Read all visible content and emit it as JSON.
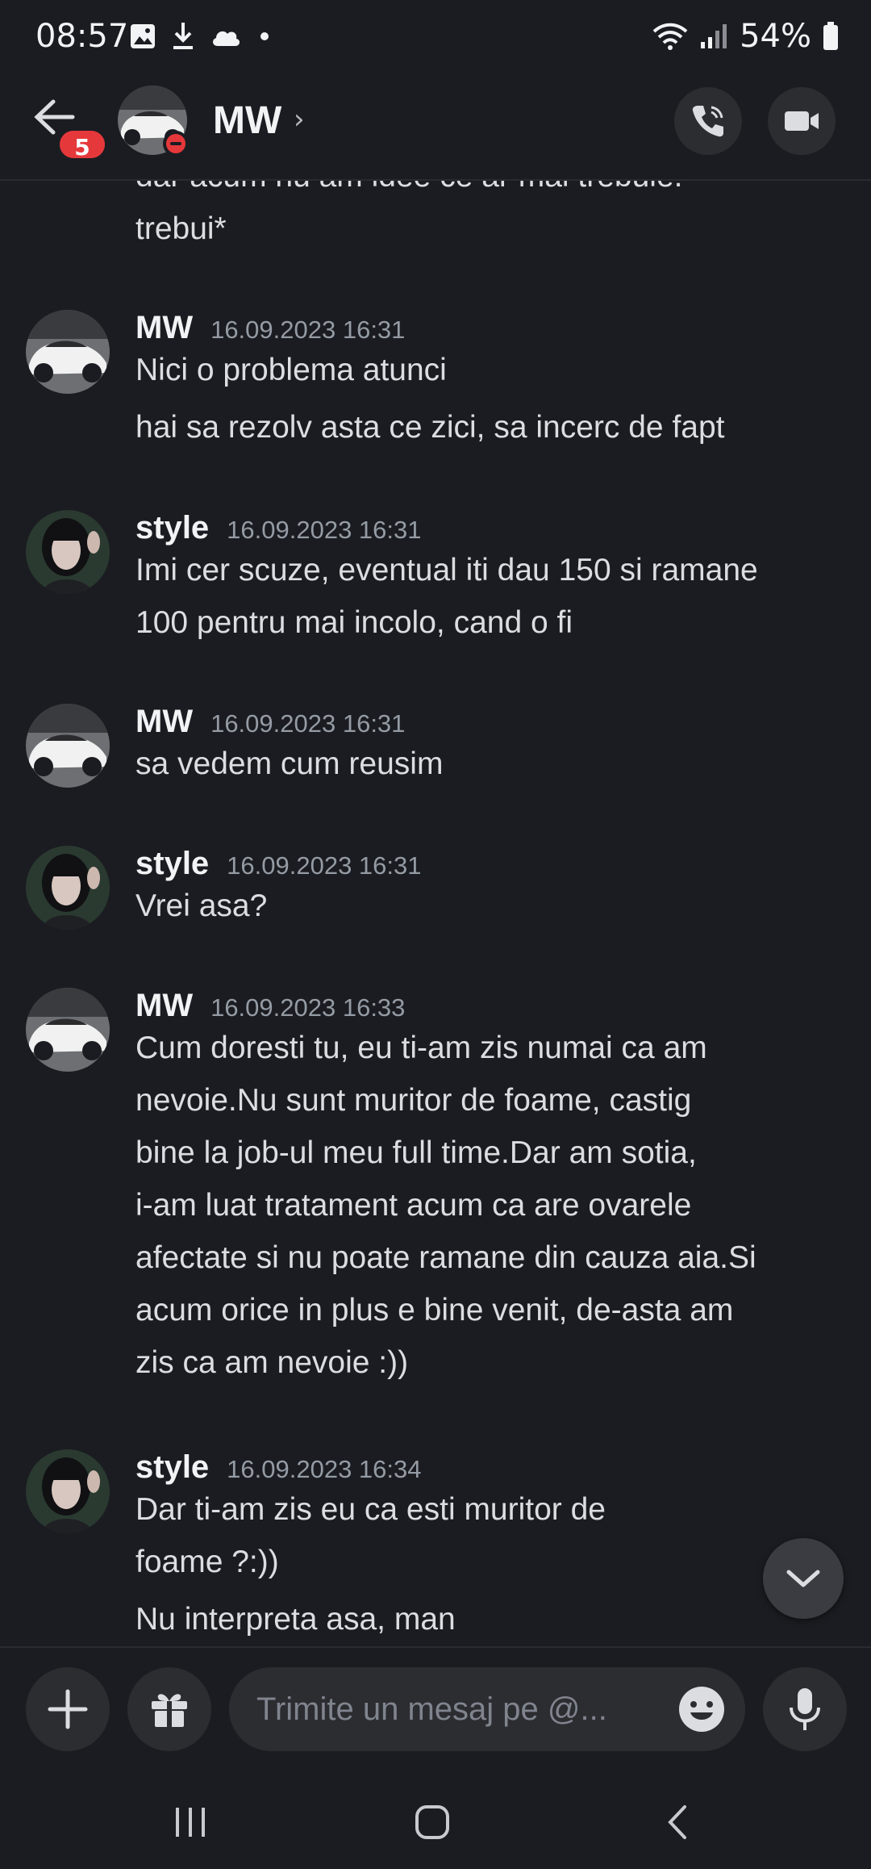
{
  "status_bar": {
    "time": "08:57",
    "battery": "54%",
    "icons": [
      "gallery-icon",
      "download-icon",
      "cloud-icon",
      "dot-icon",
      "wifi-icon",
      "signal-icon",
      "battery-icon"
    ]
  },
  "header": {
    "title": "MW",
    "chevron": "›",
    "unread_badge": "5",
    "status": "do-not-disturb",
    "buttons": [
      "voice-call-icon",
      "video-call-icon"
    ]
  },
  "messages": {
    "partial_top": {
      "lines": [
        "dar acum nu am idee ce ar mai trebuie.",
        "trebui*"
      ]
    },
    "groups": [
      {
        "author": "MW",
        "timestamp": "16.09.2023 16:31",
        "lines": [
          "Nici o problema atunci",
          "hai sa rezolv asta ce zici, sa incerc de fapt"
        ]
      },
      {
        "author": "style",
        "timestamp": "16.09.2023 16:31",
        "lines": [
          "Imi cer scuze, eventual iti dau 150 si ramane",
          "100 pentru mai incolo, cand o fi"
        ]
      },
      {
        "author": "MW",
        "timestamp": "16.09.2023 16:31",
        "lines": [
          "sa vedem cum reusim"
        ]
      },
      {
        "author": "style",
        "timestamp": "16.09.2023 16:31",
        "lines": [
          "Vrei asa?"
        ]
      },
      {
        "author": "MW",
        "timestamp": "16.09.2023 16:33",
        "lines": [
          "Cum doresti tu, eu ti-am zis numai ca am",
          "nevoie.Nu sunt muritor de foame, castig",
          "bine la job-ul meu full time.Dar am sotia,",
          "i-am luat tratament acum ca are ovarele",
          "afectate si nu poate ramane din cauza aia.Si",
          "acum orice in plus e bine venit, de-asta am",
          "zis ca am nevoie :))"
        ]
      },
      {
        "author": "style",
        "timestamp": "16.09.2023 16:34",
        "lines": [
          "Dar ti-am zis eu ca esti muritor de",
          "foame ?:))",
          "Nu interpreta asa, man"
        ]
      }
    ]
  },
  "composer": {
    "placeholder": "Trimite un mesaj pe @...",
    "buttons": [
      "plus-icon",
      "gift-icon",
      "emoji-icon",
      "microphone-icon"
    ]
  },
  "nav_bar": {
    "buttons": [
      "recents-icon",
      "home-icon",
      "back-icon"
    ]
  },
  "colors": {
    "background": "#1b1c21",
    "surface": "#2b2d31",
    "badge": "#e5383b",
    "text": "#dcdde1",
    "muted": "#949ba4"
  }
}
